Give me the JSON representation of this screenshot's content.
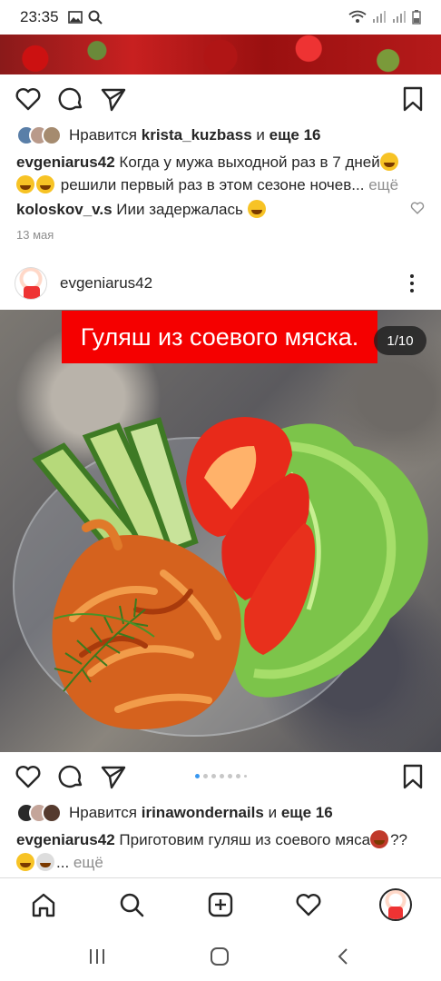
{
  "status_bar": {
    "time": "23:35"
  },
  "post1": {
    "likes": {
      "prefix": "Нравится",
      "user": "krista_kuzbass",
      "connector": "и",
      "more": "еще 16"
    },
    "caption": {
      "user": "evgeniarus42",
      "line1": "Когда у мужа выходной раз в 7 дней",
      "line2": "решили первый раз в этом сезоне ночев...",
      "more": "ещё"
    },
    "comment": {
      "user": "koloskov_v.s",
      "text": "Иии задержалась"
    },
    "date": "13 мая"
  },
  "post2": {
    "username": "evgeniarus42",
    "image_title": "Гуляш из соевого мяска.",
    "counter": "1/10",
    "carousel": {
      "current": 1,
      "dots_visible": 8
    },
    "likes": {
      "prefix": "Нравится",
      "user": "irinawondernails",
      "connector": "и",
      "more": "еще 16"
    },
    "caption": {
      "user": "evgeniarus42",
      "text": "Приготовим гуляш из соевого мяса",
      "suffix": "??",
      "line2_suffix": "...",
      "more": "ещё"
    }
  },
  "icons": {
    "like": "heart-icon",
    "comment": "comment-icon",
    "share": "send-icon",
    "save": "bookmark-icon",
    "home": "home-icon",
    "search": "search-icon",
    "new_post": "add-post-icon",
    "activity": "heart-icon",
    "profile": "avatar"
  },
  "colors": {
    "banner_red": "#f50000",
    "active_dot": "#3897f0",
    "text": "#262626",
    "muted": "#8e8e8e"
  }
}
